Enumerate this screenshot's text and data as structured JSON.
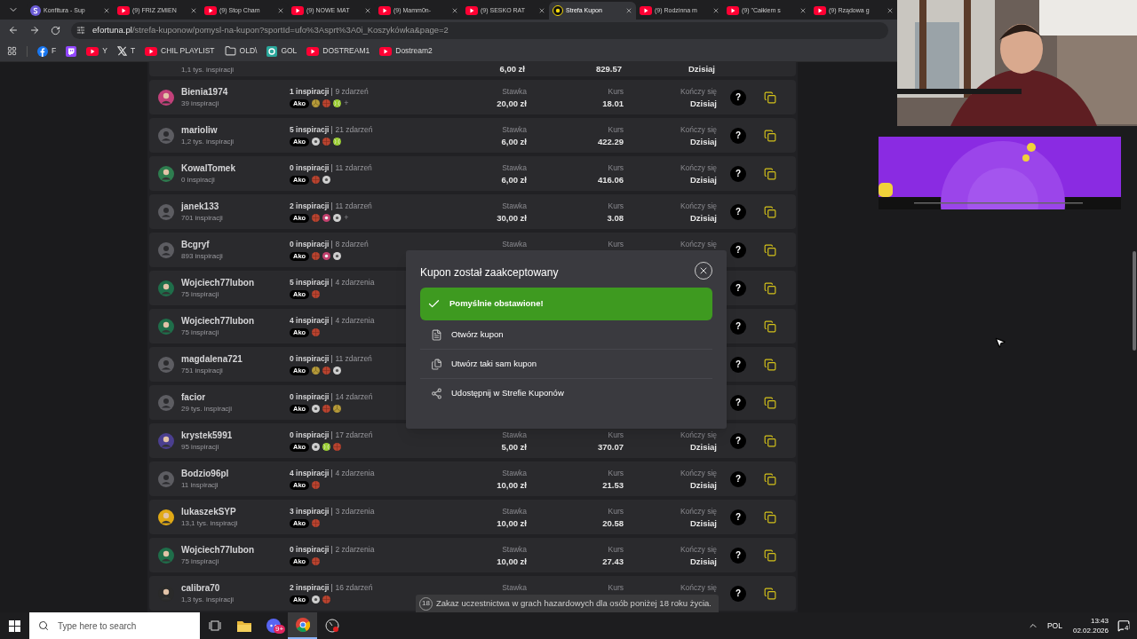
{
  "browser": {
    "tabs": [
      {
        "title": "Konfitura - Sup",
        "kind": "site",
        "selected": false
      },
      {
        "title": "(9) FRIZ ZMIEN",
        "kind": "youtube",
        "selected": false
      },
      {
        "title": "(9) Stop Cham",
        "kind": "youtube",
        "selected": false
      },
      {
        "title": "(9) NOWE MAT",
        "kind": "youtube",
        "selected": false
      },
      {
        "title": "(9) Mamm0n-",
        "kind": "youtube",
        "selected": false
      },
      {
        "title": "(9) SESKO RAT",
        "kind": "youtube",
        "selected": false
      },
      {
        "title": "Strefa Kupon",
        "kind": "fortuna",
        "selected": true
      },
      {
        "title": "(9) Rodzinna m",
        "kind": "youtube",
        "selected": false
      },
      {
        "title": "(9) \"Całkiem s",
        "kind": "youtube",
        "selected": false
      },
      {
        "title": "(9) Rządowa g",
        "kind": "youtube",
        "selected": false
      }
    ],
    "address": {
      "host": "efortuna.pl",
      "path": "/strefa-kuponow/pomysl-na-kupon?sportId=ufo%3Asprt%3A0i_Koszykówka&page=2"
    },
    "bookmarks": [
      {
        "kind": "facebook",
        "label": "F"
      },
      {
        "kind": "twitch"
      },
      {
        "kind": "youtube",
        "label": "Y"
      },
      {
        "kind": "x",
        "label": "T"
      },
      {
        "kind": "youtube",
        "label": "CHIL PLAYLIST"
      },
      {
        "kind": "folder",
        "label": "OLD\\"
      },
      {
        "kind": "gol",
        "label": "GOL"
      },
      {
        "kind": "youtube",
        "label": "DOSTREAM1"
      },
      {
        "kind": "youtube",
        "label": "Dostream2"
      }
    ]
  },
  "coupons": {
    "partial_row": {
      "inspirations": "1,1 tys. inspiracji",
      "stake": "6,00 zł",
      "odds": "829.57",
      "ends": "Dzisiaj"
    },
    "rows": [
      {
        "user": "Bienia1974",
        "inspirations": "39 inspiracji",
        "avatar": {
          "kind": "custom",
          "color": "#c2417a"
        },
        "used": "1 inspiracji",
        "events": "9 zdarzeń",
        "badge": "Ako",
        "sports": [
          {
            "kind": "volleyball"
          },
          {
            "kind": "basketball"
          },
          {
            "kind": "tennis"
          }
        ],
        "more": "+",
        "stake": {
          "label": "Stawka",
          "value": "20,00 zł"
        },
        "odds": {
          "label": "Kurs",
          "value": "18.01"
        },
        "ends": {
          "label": "Kończy się",
          "value": "Dzisiaj"
        },
        "help": "?"
      },
      {
        "user": "marioliw",
        "inspirations": "1,2 tys. inspiracji",
        "avatar": {
          "kind": "default"
        },
        "used": "5 inspiracji",
        "events": "21 zdarzeń",
        "badge": "Ako",
        "sports": [
          {
            "kind": "football"
          },
          {
            "kind": "basketball"
          },
          {
            "kind": "tennis"
          }
        ],
        "stake": {
          "label": "Stawka",
          "value": "6,00 zł"
        },
        "odds": {
          "label": "Kurs",
          "value": "422.29"
        },
        "ends": {
          "label": "Kończy się",
          "value": "Dzisiaj"
        },
        "help": "?"
      },
      {
        "user": "KowalTomek",
        "inspirations": "0 inspiracji",
        "avatar": {
          "kind": "custom",
          "color": "#2e7d4f"
        },
        "used": "0 inspiracji",
        "events": "11 zdarzeń",
        "badge": "Ako",
        "sports": [
          {
            "kind": "basketball"
          },
          {
            "kind": "football"
          }
        ],
        "stake": {
          "label": "Stawka",
          "value": "6,00 zł"
        },
        "odds": {
          "label": "Kurs",
          "value": "416.06"
        },
        "ends": {
          "label": "Kończy się",
          "value": "Dzisiaj"
        },
        "help": "?"
      },
      {
        "user": "janek133",
        "inspirations": "701 inspiracji",
        "avatar": {
          "kind": "default"
        },
        "used": "2 inspiracji",
        "events": "11 zdarzeń",
        "badge": "Ako",
        "sports": [
          {
            "kind": "basketball"
          },
          {
            "kind": "other"
          },
          {
            "kind": "football"
          }
        ],
        "more": "+",
        "stake": {
          "label": "Stawka",
          "value": "30,00 zł"
        },
        "odds": {
          "label": "Kurs",
          "value": "3.08"
        },
        "ends": {
          "label": "Kończy się",
          "value": "Dzisiaj"
        },
        "help": "?"
      },
      {
        "user": "Bcgryf",
        "inspirations": "893 inspiracji",
        "avatar": {
          "kind": "default"
        },
        "used": "0 inspiracji",
        "events": "8 zdarzeń",
        "badge": "Ako",
        "sports": [
          {
            "kind": "basketball"
          },
          {
            "kind": "other"
          },
          {
            "kind": "football"
          }
        ],
        "stake": {
          "label": "Stawka"
        },
        "odds": {
          "label": "Kurs"
        },
        "ends": {
          "label": "Kończy się"
        },
        "help": "?"
      },
      {
        "user": "Wojciech77lubon",
        "inspirations": "75 inspiracji",
        "avatar": {
          "kind": "custom",
          "color": "#1f6e4a"
        },
        "used": "5 inspiracji",
        "events": "4 zdarzenia",
        "badge": "Ako",
        "sports": [
          {
            "kind": "basketball"
          }
        ],
        "help": "?"
      },
      {
        "user": "Wojciech77lubon",
        "inspirations": "75 inspiracji",
        "avatar": {
          "kind": "custom",
          "color": "#1f6e4a"
        },
        "used": "4 inspiracji",
        "events": "4 zdarzenia",
        "badge": "Ako",
        "sports": [
          {
            "kind": "basketball"
          }
        ],
        "help": "?"
      },
      {
        "user": "magdalena721",
        "inspirations": "751 inspiracji",
        "avatar": {
          "kind": "default"
        },
        "used": "0 inspiracji",
        "events": "11 zdarzeń",
        "badge": "Ako",
        "sports": [
          {
            "kind": "volleyball"
          },
          {
            "kind": "basketball"
          },
          {
            "kind": "football"
          }
        ],
        "help": "?"
      },
      {
        "user": "facior",
        "inspirations": "29 tys. inspiracji",
        "avatar": {
          "kind": "default"
        },
        "used": "0 inspiracji",
        "events": "14 zdarzeń",
        "badge": "Ako",
        "sports": [
          {
            "kind": "football"
          },
          {
            "kind": "basketball"
          },
          {
            "kind": "volleyball"
          }
        ],
        "help": "?"
      },
      {
        "user": "krystek5991",
        "inspirations": "95 inspiracji",
        "avatar": {
          "kind": "custom",
          "color": "#4b3f8f"
        },
        "used": "0 inspiracji",
        "events": "17 zdarzeń",
        "badge": "Ako",
        "sports": [
          {
            "kind": "football"
          },
          {
            "kind": "tennis"
          },
          {
            "kind": "basketball"
          }
        ],
        "stake": {
          "label": "Stawka",
          "value": "5,00 zł"
        },
        "odds": {
          "label": "Kurs",
          "value": "370.07"
        },
        "ends": {
          "label": "Kończy się",
          "value": "Dzisiaj"
        },
        "help": "?"
      },
      {
        "user": "Bodzio96pl",
        "inspirations": "11 inspiracji",
        "avatar": {
          "kind": "default"
        },
        "used": "4 inspiracji",
        "events": "4 zdarzenia",
        "badge": "Ako",
        "sports": [
          {
            "kind": "basketball"
          }
        ],
        "stake": {
          "label": "Stawka",
          "value": "10,00 zł"
        },
        "odds": {
          "label": "Kurs",
          "value": "21.53"
        },
        "ends": {
          "label": "Kończy się",
          "value": "Dzisiaj"
        },
        "help": "?"
      },
      {
        "user": "lukaszekSYP",
        "inspirations": "13,1 tys. inspiracji",
        "avatar": {
          "kind": "custom",
          "color": "#e0a916"
        },
        "used": "3 inspiracji",
        "events": "3 zdarzenia",
        "badge": "Ako",
        "sports": [
          {
            "kind": "basketball"
          }
        ],
        "stake": {
          "label": "Stawka",
          "value": "10,00 zł"
        },
        "odds": {
          "label": "Kurs",
          "value": "20.58"
        },
        "ends": {
          "label": "Kończy się",
          "value": "Dzisiaj"
        },
        "help": "?"
      },
      {
        "user": "Wojciech77lubon",
        "inspirations": "75 inspiracji",
        "avatar": {
          "kind": "custom",
          "color": "#1f6e4a"
        },
        "used": "0 inspiracji",
        "events": "2 zdarzenia",
        "badge": "Ako",
        "sports": [
          {
            "kind": "basketball"
          }
        ],
        "stake": {
          "label": "Stawka",
          "value": "10,00 zł"
        },
        "odds": {
          "label": "Kurs",
          "value": "27.43"
        },
        "ends": {
          "label": "Kończy się",
          "value": "Dzisiaj"
        },
        "help": "?"
      },
      {
        "user": "calibra70",
        "inspirations": "1,3 tys. inspiracji",
        "avatar": {
          "kind": "custom",
          "color": "#2a2a2a"
        },
        "used": "2 inspiracji",
        "events": "16 zdarzeń",
        "badge": "Ako",
        "sports": [
          {
            "kind": "football"
          },
          {
            "kind": "basketball"
          }
        ],
        "stake": {
          "label": "Stawka"
        },
        "odds": {
          "label": "Kurs"
        },
        "ends": {
          "label": "Kończy się"
        },
        "help": "?"
      }
    ]
  },
  "modal": {
    "title": "Kupon został zaakceptowany",
    "success": "Pomyślnie obstawione!",
    "actions": [
      {
        "kind": "open",
        "label": "Otwórz kupon"
      },
      {
        "kind": "copy",
        "label": "Utwórz taki sam kupon"
      },
      {
        "kind": "share",
        "label": "Udostępnij w Strefie Kuponów"
      }
    ]
  },
  "notice": {
    "badge": "18",
    "text": "Zakaz uczestnictwa w grach hazardowych dla osób poniżej 18 roku życia."
  },
  "taskbar": {
    "search_placeholder": "Type here to search",
    "apps": [
      {
        "kind": "taskview",
        "selected": false
      },
      {
        "kind": "explorer",
        "selected": false
      },
      {
        "kind": "discord",
        "badge": "9+",
        "selected": false
      },
      {
        "kind": "chrome",
        "selected": true
      },
      {
        "kind": "recorder",
        "selected": false
      }
    ],
    "language": "POL",
    "time": "13:43",
    "date": "02.02.2026",
    "notifications": "4"
  }
}
